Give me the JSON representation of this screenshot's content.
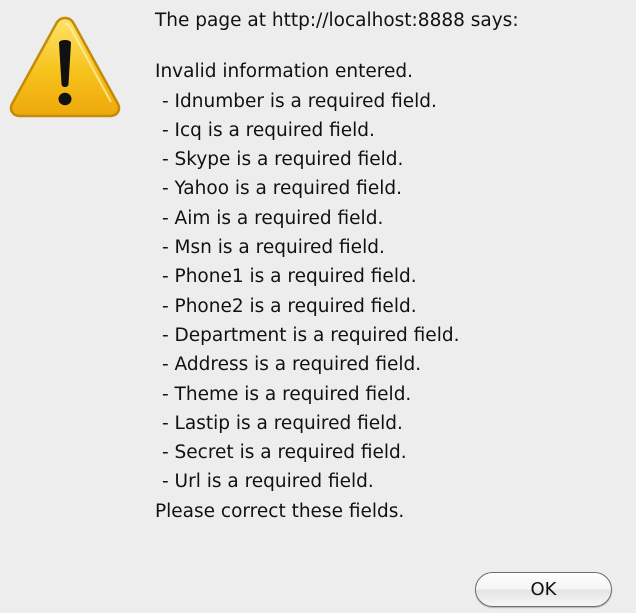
{
  "dialog": {
    "title": "The page at http://localhost:8888 says:",
    "icon": "warning-triangle-icon",
    "message": {
      "intro": "Invalid information entered.",
      "items": [
        "- Idnumber is a required field.",
        "- Icq is a required field.",
        "- Skype is a required field.",
        "- Yahoo is a required field.",
        "- Aim is a required field.",
        "- Msn is a required field.",
        "- Phone1 is a required field.",
        "- Phone2 is a required field.",
        "- Department is a required field.",
        "- Address is a required field.",
        "- Theme is a required field.",
        "- Lastip is a required field.",
        "- Secret is a required field.",
        "- Url is a required field."
      ],
      "outro": "Please correct these fields."
    },
    "ok_label": "OK"
  },
  "colors": {
    "background": "#ededed",
    "icon_yellow": "#f7c21b",
    "icon_outline": "#c48a0a",
    "text": "#111111"
  }
}
